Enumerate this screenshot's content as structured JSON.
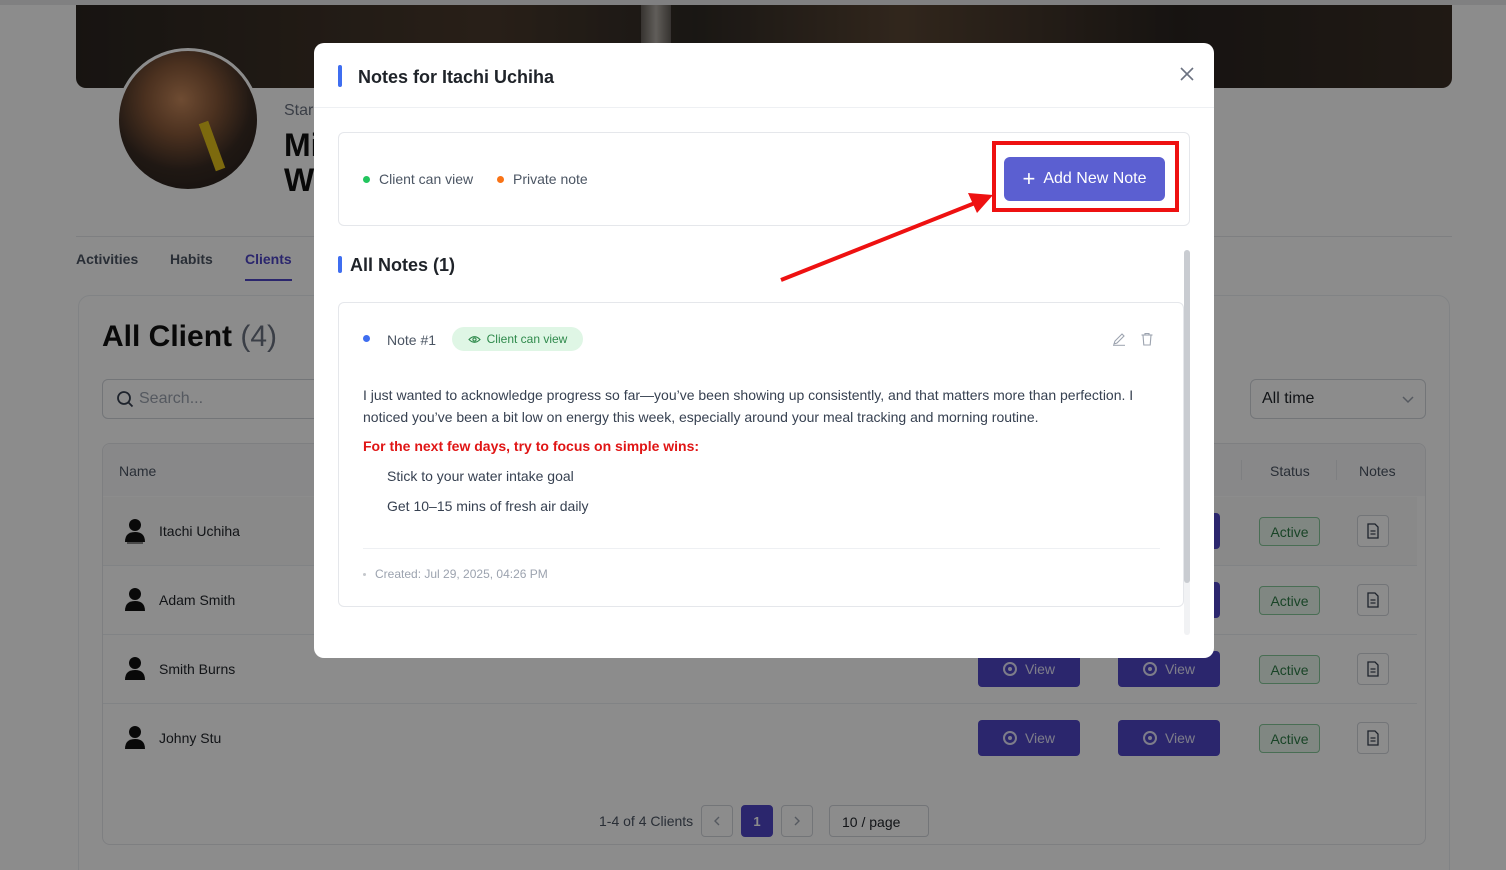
{
  "profile": {
    "subtitle": "Star",
    "name_line1": "Mi",
    "name_line2": "W"
  },
  "tabs": [
    "Activities",
    "Habits",
    "Clients"
  ],
  "clients": {
    "title": "All Client",
    "count": "(4)",
    "search_placeholder": "Search...",
    "time_filter": "All time",
    "columns": {
      "name": "Name",
      "status": "Status",
      "notes": "Notes"
    },
    "rows": [
      {
        "name": "Itachi Uchiha",
        "status": "Active"
      },
      {
        "name": "Adam Smith",
        "status": "Active"
      },
      {
        "name": "Smith Burns",
        "status": "Active",
        "view1": "View",
        "view2": "View"
      },
      {
        "name": "Johny Stu",
        "status": "Active",
        "view1": "View",
        "view2": "View"
      }
    ],
    "pagination": {
      "summary": "1-4 of 4 Clients",
      "current": "1",
      "page_size": "10 / page"
    }
  },
  "modal": {
    "title": "Notes for Itachi Uchiha",
    "legend": {
      "client_can_view": "Client can view",
      "private_note": "Private note"
    },
    "add_button": "Add New Note",
    "all_notes_title": "All Notes (1)",
    "note": {
      "title": "Note #1",
      "badge": "Client can view",
      "body": "I just wanted to acknowledge progress so far—you’ve been showing up consistently, and that matters more than perfection. I noticed you’ve been a bit low on energy this week, especially around your meal tracking and morning routine.",
      "emphasis": "For the next few days, try to focus on simple wins:",
      "items": [
        "Stick to your water intake goal",
        "Get 10–15 mins of fresh air daily"
      ],
      "created": "Created: Jul 29, 2025, 04:26 PM"
    }
  },
  "colors": {
    "primary": "#4f46c6",
    "add_button": "#5b5fd1",
    "accent_blue": "#3f6ef0",
    "legend_green": "#22c55e",
    "legend_orange": "#f97316",
    "emphasis_red": "#e01515",
    "annotation_red": "#ee1111"
  }
}
